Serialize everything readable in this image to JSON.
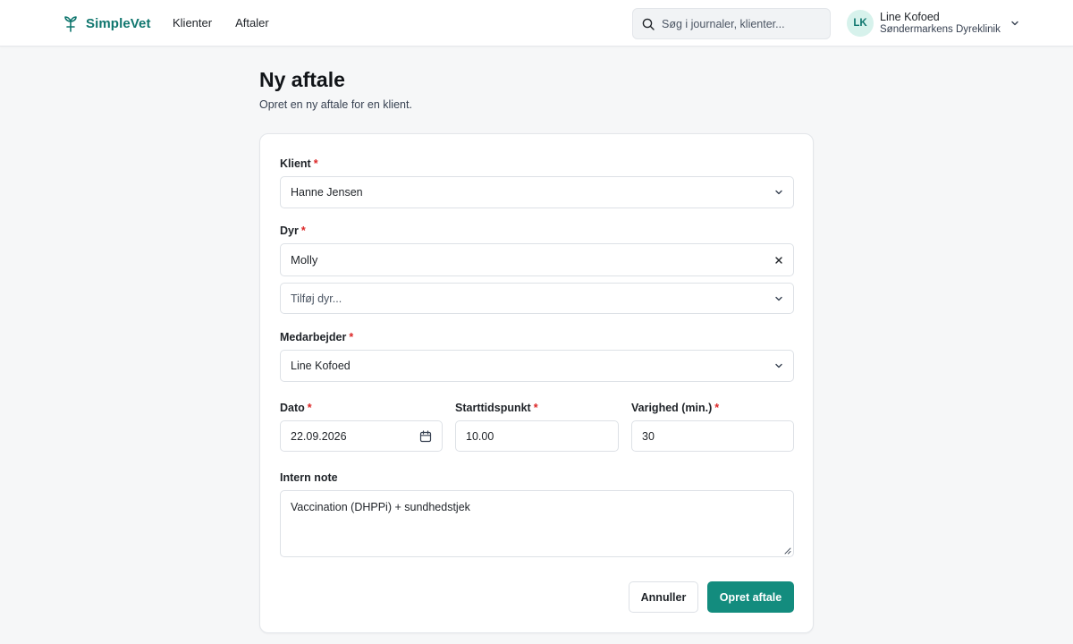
{
  "app": {
    "brand_name": "SimpleVet",
    "brand_color": "#0f766e",
    "accent_color": "#138c7e",
    "logo_icon": "pet-care-logo-icon"
  },
  "nav": {
    "items": [
      {
        "label": "Klienter"
      },
      {
        "label": "Aftaler"
      }
    ]
  },
  "search": {
    "placeholder": "Søg i journaler, klienter...",
    "icon": "search-icon"
  },
  "user": {
    "initials": "LK",
    "name": "Line Kofoed",
    "clinic": "Søndermarkens Dyreklinik"
  },
  "page": {
    "title": "Ny aftale",
    "subtitle": "Opret en ny aftale for en klient."
  },
  "form": {
    "client": {
      "label": "Klient",
      "required_mark": "*",
      "value": "Hanne Jensen"
    },
    "animal": {
      "label": "Dyr",
      "required_mark": "*",
      "selected": "Molly",
      "add_placeholder": "Tilføj dyr..."
    },
    "staff": {
      "label": "Medarbejder",
      "required_mark": "*",
      "value": "Line Kofoed"
    },
    "date": {
      "label": "Dato",
      "required_mark": "*",
      "value": "22.09.2026"
    },
    "start_time": {
      "label": "Starttidspunkt",
      "required_mark": "*",
      "value": "10.00"
    },
    "duration": {
      "label": "Varighed (min.)",
      "required_mark": "*",
      "value": "30"
    },
    "note": {
      "label": "Intern note",
      "value": "Vaccination (DHPPi) + sundhedstjek"
    }
  },
  "actions": {
    "cancel_label": "Annuller",
    "submit_label": "Opret aftale"
  }
}
